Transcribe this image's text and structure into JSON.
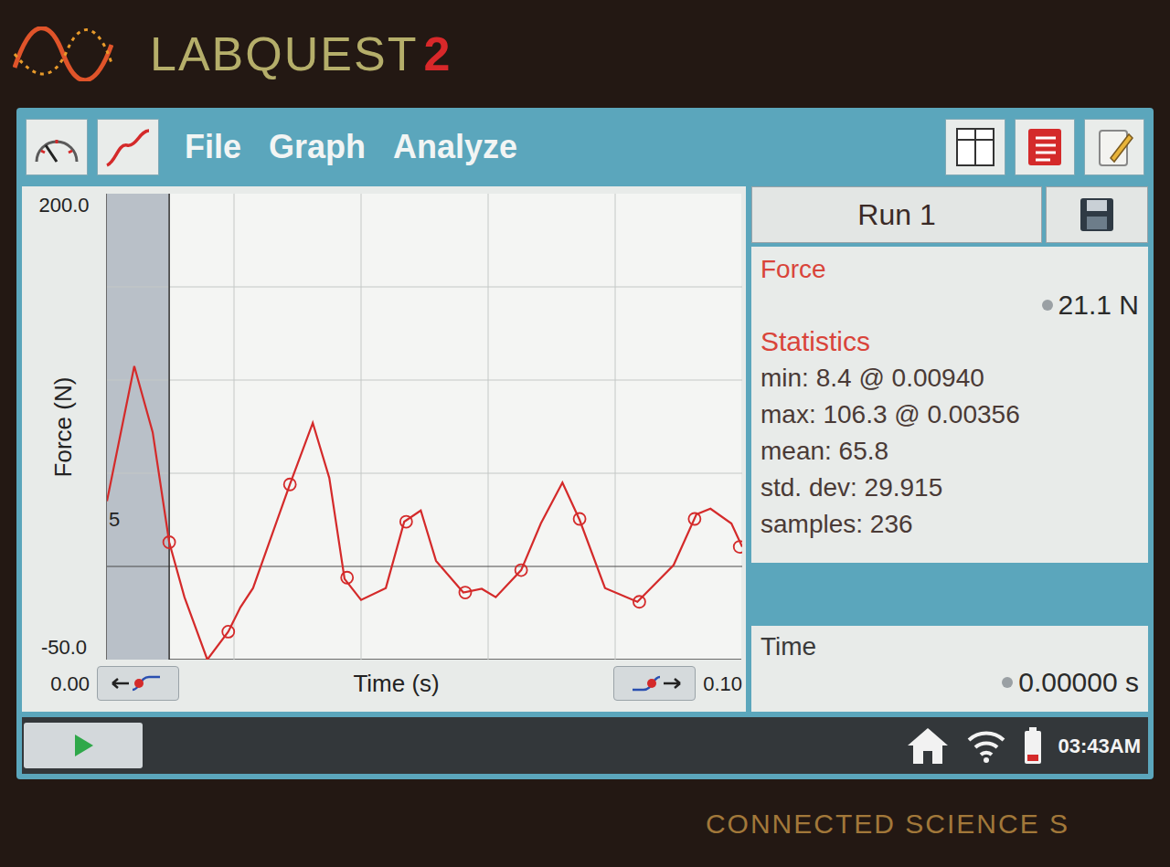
{
  "device": {
    "brand": "LABQUEST",
    "model": "2",
    "footer": "CONNECTED SCIENCE S"
  },
  "menu": [
    "File",
    "Graph",
    "Analyze"
  ],
  "graph": {
    "y_axis": {
      "label": "Force (N)",
      "max": "200.0",
      "min": "-50.0",
      "partial_label": "5"
    },
    "x_axis": {
      "label": "Time (s)",
      "min": "0.00",
      "max": "0.10"
    },
    "selection": {
      "start": 0,
      "end": 0.0098
    },
    "series": [
      {
        "name": "Force",
        "color": "#d42a2a",
        "times": [
          0,
          0.0043,
          0.0072,
          0.0098,
          0.0122,
          0.0158,
          0.0191,
          0.021,
          0.023,
          0.0266,
          0.0288,
          0.0324,
          0.035,
          0.0374,
          0.04,
          0.0439,
          0.0468,
          0.0494,
          0.0518,
          0.0561,
          0.059,
          0.0612,
          0.0652,
          0.0683,
          0.0717,
          0.0744,
          0.0784,
          0.0835,
          0.0892,
          0.0928,
          0.095,
          0.0983,
          0.1
        ],
        "values": [
          35,
          107.5,
          72,
          13,
          -16.5,
          -50,
          -35,
          -22,
          -11.6,
          23,
          44,
          77,
          47.5,
          -6.7,
          -18,
          -11.6,
          24,
          30,
          3,
          -14,
          -12,
          -16.5,
          -2,
          23,
          45,
          25,
          -11.6,
          -19,
          0.7,
          28,
          31,
          23,
          10.5
        ]
      }
    ],
    "markers": [
      {
        "time": 0.0098,
        "value": 13
      },
      {
        "time": 0.0191,
        "value": -35
      },
      {
        "time": 0.0288,
        "value": 44
      },
      {
        "time": 0.0378,
        "value": -6
      },
      {
        "time": 0.0471,
        "value": 24
      },
      {
        "time": 0.0564,
        "value": -14
      },
      {
        "time": 0.0652,
        "value": -2
      },
      {
        "time": 0.0744,
        "value": 25.5
      },
      {
        "time": 0.0838,
        "value": -19
      },
      {
        "time": 0.0925,
        "value": 25.5
      },
      {
        "time": 0.0996,
        "value": 10.5
      }
    ]
  },
  "run": {
    "label": "Run 1"
  },
  "meters": [
    {
      "name": "Force",
      "reading": "21.1 N"
    }
  ],
  "statistics": {
    "title": "Statistics",
    "lines": [
      "min: 8.4 @ 0.00940",
      "max: 106.3 @ 0.00356",
      "mean: 65.8",
      "std. dev: 29.915",
      "samples: 236"
    ]
  },
  "time_meter": {
    "name": "Time",
    "reading": "0.00000 s"
  },
  "status_bar": {
    "time": "03:43AM"
  }
}
